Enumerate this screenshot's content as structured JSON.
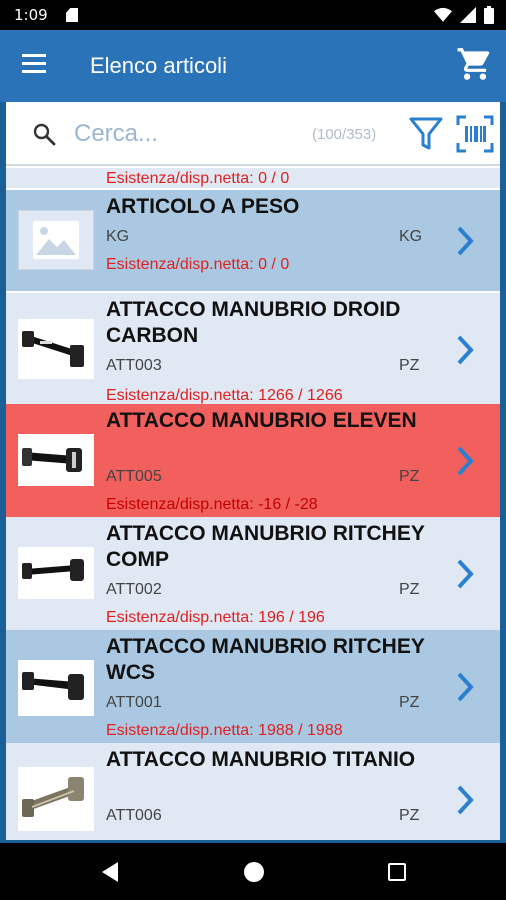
{
  "status_bar": {
    "time": "1:09",
    "icons": [
      "sd-card-icon",
      "wifi-icon",
      "signal-icon",
      "battery-icon"
    ]
  },
  "app_bar": {
    "title": "Elenco articoli",
    "icons": [
      "menu-icon",
      "cart-icon"
    ]
  },
  "search": {
    "placeholder": "Cerca...",
    "count": "(100/353)",
    "icons": [
      "search-icon",
      "filter-icon",
      "barcode-scan-icon"
    ]
  },
  "partial_row": {
    "stock": "Esistenza/disp.netta: 0 / 0"
  },
  "items": [
    {
      "name": "ARTICOLO A PESO",
      "code": "KG",
      "unit": "KG",
      "stock": "Esistenza/disp.netta: 0 / 0",
      "style": "blue",
      "thumb": "image-placeholder-icon"
    },
    {
      "name": "ATTACCO MANUBRIO DROID CARBON",
      "code": "ATT003",
      "unit": "PZ",
      "stock": "Esistenza/disp.netta: 1266 / 1266",
      "style": "light",
      "thumb": "stem-photo"
    },
    {
      "name": "ATTACCO MANUBRIO ELEVEN",
      "code": "ATT005",
      "unit": "PZ",
      "stock": "Esistenza/disp.netta: -16 / -28",
      "style": "red",
      "thumb": "stem-photo"
    },
    {
      "name": "ATTACCO MANUBRIO RITCHEY COMP",
      "code": "ATT002",
      "unit": "PZ",
      "stock": "Esistenza/disp.netta: 196 / 196",
      "style": "light",
      "thumb": "stem-photo"
    },
    {
      "name": "ATTACCO MANUBRIO RITCHEY WCS",
      "code": "ATT001",
      "unit": "PZ",
      "stock": "Esistenza/disp.netta: 1988 / 1988",
      "style": "blue",
      "thumb": "stem-photo"
    },
    {
      "name": "ATTACCO MANUBRIO TITANIO",
      "code": "ATT006",
      "unit": "PZ",
      "stock": "",
      "style": "light",
      "thumb": "stem-photo-silver"
    }
  ],
  "nav_bar": {
    "icons": [
      "back-icon",
      "home-icon",
      "recents-icon"
    ]
  },
  "colors": {
    "app_bar": "#2a73b8",
    "accent": "#2a7fd0",
    "row_light": "#dfe8f3",
    "row_blue": "#aac8e2",
    "row_negative": "#f2605e",
    "stock_text": "#e02020"
  }
}
